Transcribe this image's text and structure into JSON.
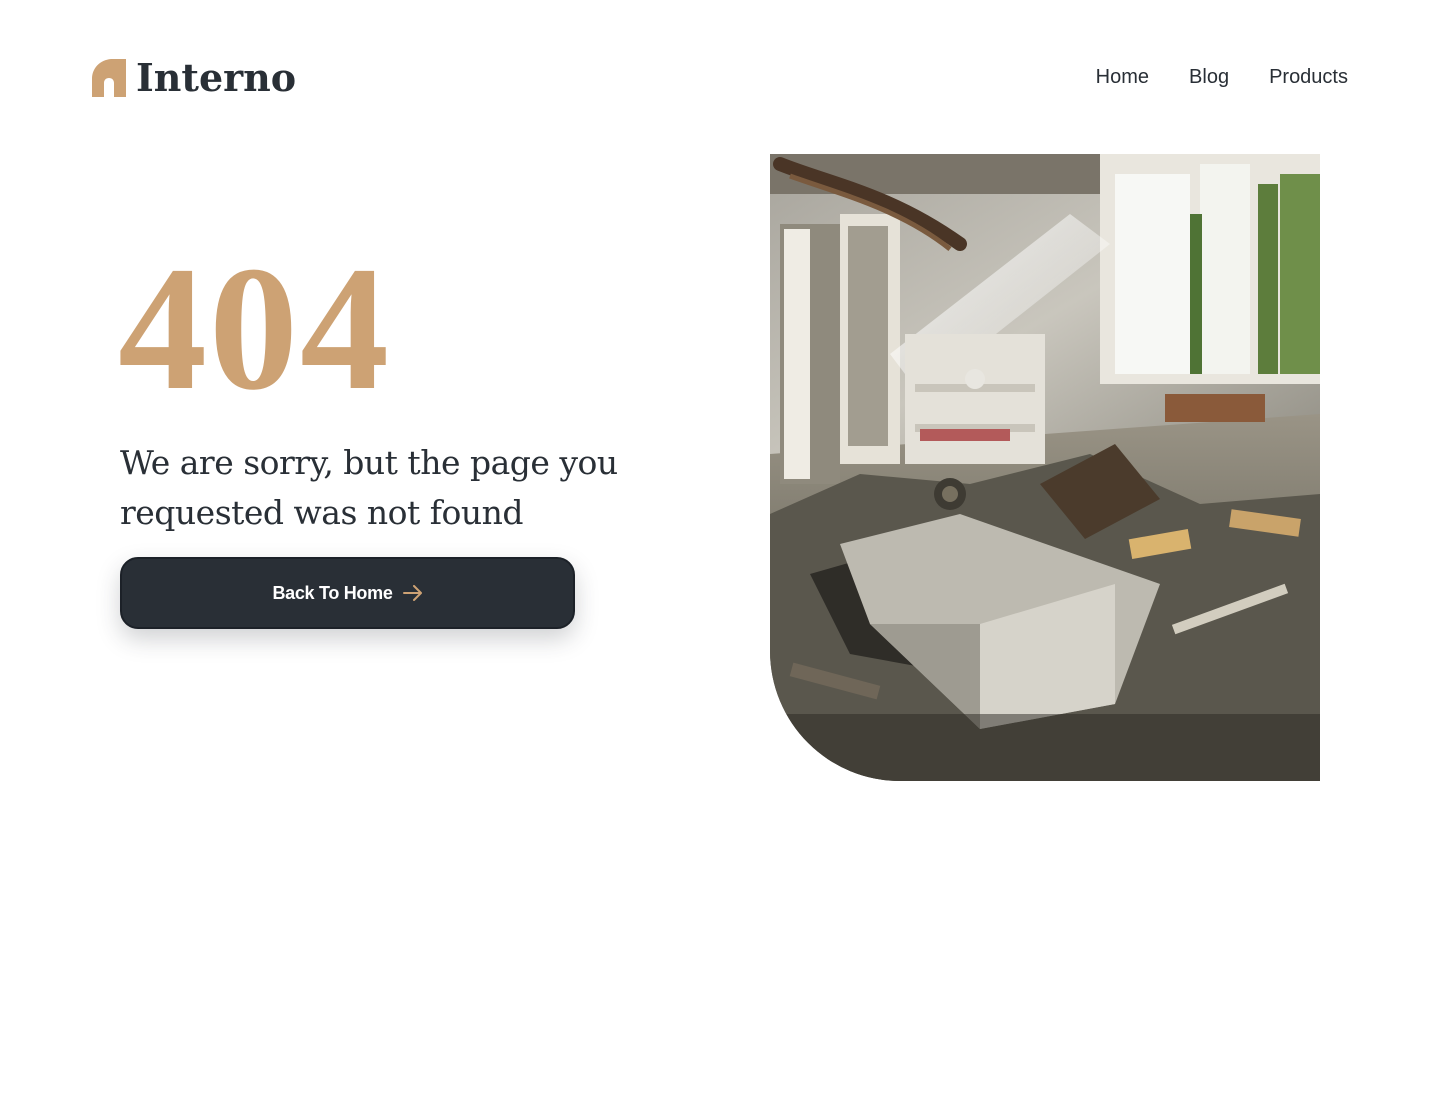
{
  "header": {
    "logo_text": "Interno",
    "logo_icon": "arch-logo-icon",
    "nav": [
      {
        "label": "Home"
      },
      {
        "label": "Blog"
      },
      {
        "label": "Products"
      }
    ]
  },
  "main": {
    "error_code": "404",
    "message": "We are sorry, but the page you requested was not found",
    "button_label": "Back To Home",
    "button_icon": "arrow-right-icon"
  },
  "photo": {
    "subject": "abandoned-room-photo"
  },
  "colors": {
    "accent": "#cda274",
    "dark": "#292f36",
    "background": "#ffffff"
  }
}
